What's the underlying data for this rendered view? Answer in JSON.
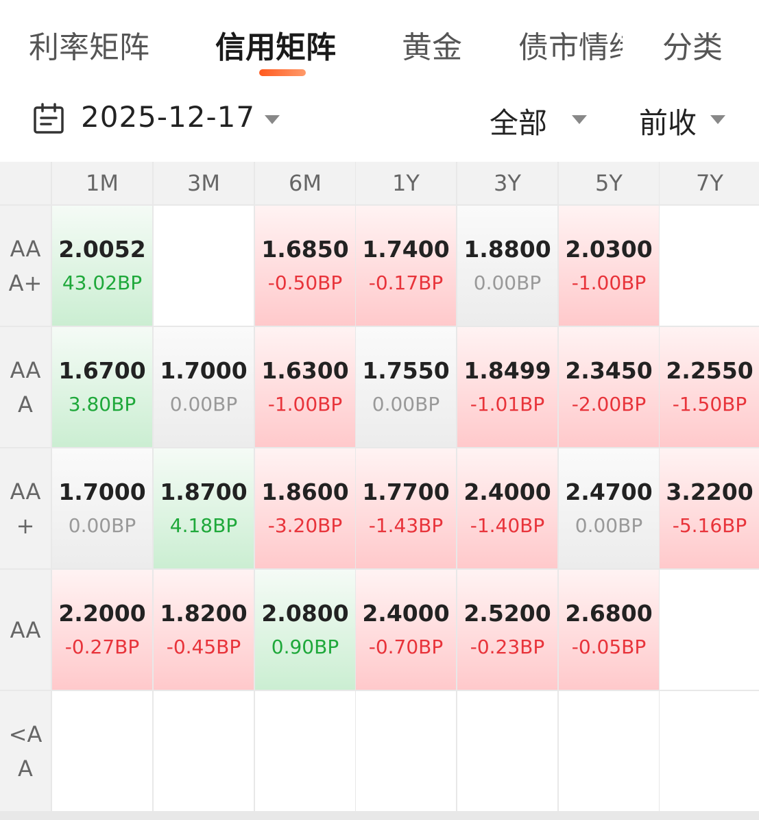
{
  "tabs": [
    {
      "label": "利率矩阵",
      "active": false
    },
    {
      "label": "信用矩阵",
      "active": true
    },
    {
      "label": "黄金",
      "active": false
    },
    {
      "label": "债市情绪",
      "active": false
    },
    {
      "label": "分类",
      "active": false
    }
  ],
  "filter": {
    "date": "2025-12-17",
    "scope": "全部",
    "compare": "前收"
  },
  "colors": {
    "accent": "#ff5a1f",
    "up": "#e8333a",
    "down": "#1ea83a",
    "flat": "#999999"
  },
  "matrix": {
    "columns": [
      "1M",
      "3M",
      "6M",
      "1Y",
      "3Y",
      "5Y",
      "7Y"
    ],
    "rows": [
      {
        "label": "AAA+",
        "cells": [
          {
            "value": "2.0052",
            "change": "43.02BP",
            "trend": "down"
          },
          null,
          {
            "value": "1.6850",
            "change": "-0.50BP",
            "trend": "up"
          },
          {
            "value": "1.7400",
            "change": "-0.17BP",
            "trend": "up"
          },
          {
            "value": "1.8800",
            "change": "0.00BP",
            "trend": "flat"
          },
          {
            "value": "2.0300",
            "change": "-1.00BP",
            "trend": "up"
          },
          null
        ]
      },
      {
        "label": "AAA",
        "cells": [
          {
            "value": "1.6700",
            "change": "3.80BP",
            "trend": "down"
          },
          {
            "value": "1.7000",
            "change": "0.00BP",
            "trend": "flat"
          },
          {
            "value": "1.6300",
            "change": "-1.00BP",
            "trend": "up"
          },
          {
            "value": "1.7550",
            "change": "0.00BP",
            "trend": "flat"
          },
          {
            "value": "1.8499",
            "change": "-1.01BP",
            "trend": "up"
          },
          {
            "value": "2.3450",
            "change": "-2.00BP",
            "trend": "up"
          },
          {
            "value": "2.2550",
            "change": "-1.50BP",
            "trend": "up"
          }
        ]
      },
      {
        "label": "AA+",
        "cells": [
          {
            "value": "1.7000",
            "change": "0.00BP",
            "trend": "flat"
          },
          {
            "value": "1.8700",
            "change": "4.18BP",
            "trend": "down"
          },
          {
            "value": "1.8600",
            "change": "-3.20BP",
            "trend": "up"
          },
          {
            "value": "1.7700",
            "change": "-1.43BP",
            "trend": "up"
          },
          {
            "value": "2.4000",
            "change": "-1.40BP",
            "trend": "up"
          },
          {
            "value": "2.4700",
            "change": "0.00BP",
            "trend": "flat"
          },
          {
            "value": "3.2200",
            "change": "-5.16BP",
            "trend": "up"
          }
        ]
      },
      {
        "label": "AA",
        "cells": [
          {
            "value": "2.2000",
            "change": "-0.27BP",
            "trend": "up"
          },
          {
            "value": "1.8200",
            "change": "-0.45BP",
            "trend": "up"
          },
          {
            "value": "2.0800",
            "change": "0.90BP",
            "trend": "down"
          },
          {
            "value": "2.4000",
            "change": "-0.70BP",
            "trend": "up"
          },
          {
            "value": "2.5200",
            "change": "-0.23BP",
            "trend": "up"
          },
          {
            "value": "2.6800",
            "change": "-0.05BP",
            "trend": "up"
          },
          null
        ]
      },
      {
        "label": "<AA",
        "cells": [
          null,
          null,
          null,
          null,
          null,
          null,
          null
        ]
      }
    ]
  }
}
